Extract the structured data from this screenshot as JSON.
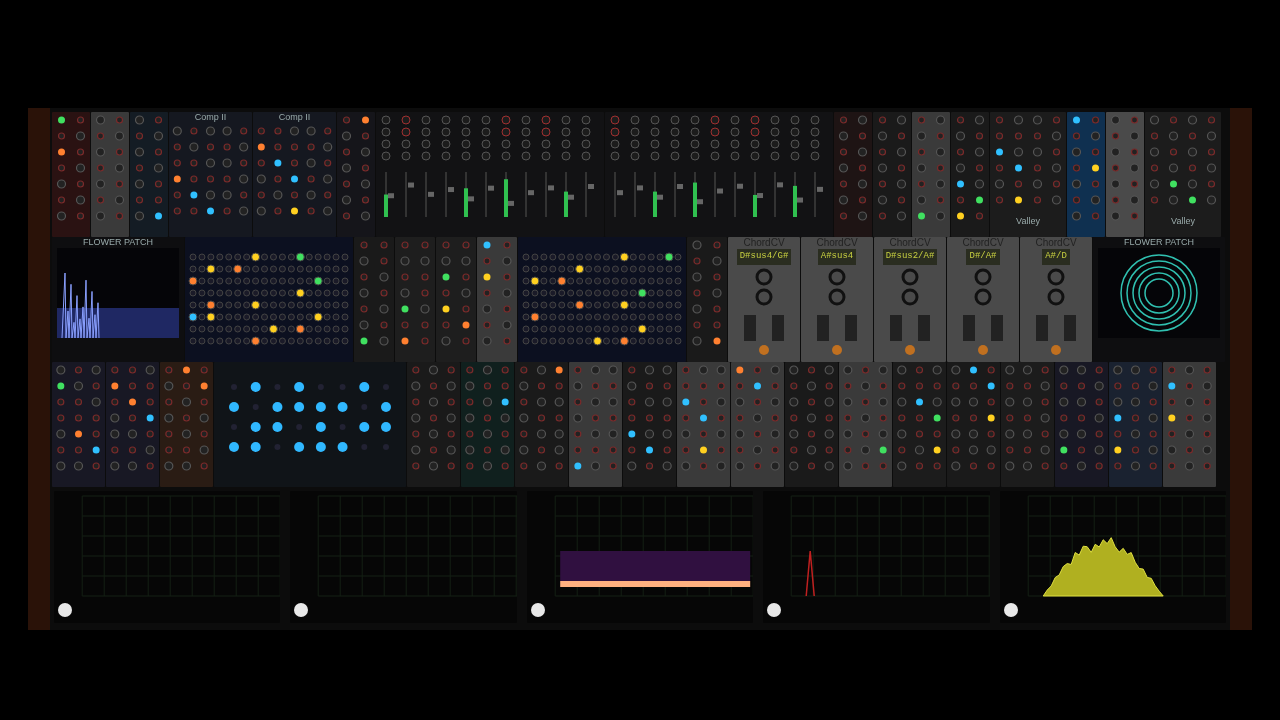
{
  "rack": {
    "rows": [
      {
        "modules": [
          {
            "kind": "panel",
            "color": "#2a1212"
          },
          {
            "kind": "panel",
            "color": "#3a3a3a"
          },
          {
            "kind": "panel",
            "color": "#141c24"
          },
          {
            "kind": "comp",
            "title": "Comp II"
          },
          {
            "kind": "comp",
            "title": "Comp II"
          },
          {
            "kind": "panel",
            "color": "#15151a"
          },
          {
            "kind": "mixer"
          },
          {
            "kind": "mixer"
          },
          {
            "kind": "panel",
            "color": "#1e1414"
          },
          {
            "kind": "panel",
            "color": "#1a1a1a"
          },
          {
            "kind": "panel",
            "color": "#3a3a3a"
          },
          {
            "kind": "panel",
            "color": "#1a1a1a"
          },
          {
            "kind": "valley",
            "title": "Valley",
            "color": "#1c1c1c"
          },
          {
            "kind": "panel",
            "color": "#0f3050"
          },
          {
            "kind": "panel",
            "color": "#4a4a4a"
          },
          {
            "kind": "valley",
            "title": "Valley",
            "color": "#1c1c1c"
          }
        ]
      },
      {
        "modules": [
          {
            "kind": "spectrum",
            "title": "FLOWER PATCH"
          },
          {
            "kind": "sequencer"
          },
          {
            "kind": "panel",
            "color": "#1a1a1a"
          },
          {
            "kind": "panel",
            "color": "#1e1e1e"
          },
          {
            "kind": "panel",
            "color": "#1e1e1e"
          },
          {
            "kind": "panel",
            "color": "#3a3a3a"
          },
          {
            "kind": "sequencer"
          },
          {
            "kind": "panel",
            "color": "#1a1a1a"
          },
          {
            "kind": "chordcv",
            "title": "ChordCV",
            "chord": "D#sus4/G#"
          },
          {
            "kind": "chordcv",
            "title": "ChordCV",
            "chord": "A#sus4"
          },
          {
            "kind": "chordcv",
            "title": "ChordCV",
            "chord": "D#sus2/A#"
          },
          {
            "kind": "chordcv",
            "title": "ChordCV",
            "chord": "D#/A#"
          },
          {
            "kind": "chordcv",
            "title": "ChordCV",
            "chord": "A#/D"
          },
          {
            "kind": "ring",
            "title": "FLOWER PATCH"
          }
        ]
      },
      {
        "modules": [
          {
            "kind": "panel",
            "color": "#181824"
          },
          {
            "kind": "panel",
            "color": "#181824"
          },
          {
            "kind": "panel",
            "color": "#2a1c14"
          },
          {
            "kind": "grid"
          },
          {
            "kind": "panel",
            "color": "#1a1a1a"
          },
          {
            "kind": "panel",
            "color": "#10201e"
          },
          {
            "kind": "panel",
            "color": "#1a1a1a"
          },
          {
            "kind": "panel",
            "color": "#3a3a3a"
          },
          {
            "kind": "panel",
            "color": "#1a1a1a"
          },
          {
            "kind": "panel",
            "color": "#3a3a3a"
          },
          {
            "kind": "panel",
            "color": "#3a3a3a"
          },
          {
            "kind": "panel",
            "color": "#1a1a1a"
          },
          {
            "kind": "panel",
            "color": "#3a3a3a"
          },
          {
            "kind": "panel",
            "color": "#1c1c1c"
          },
          {
            "kind": "panel",
            "color": "#1a1a1a"
          },
          {
            "kind": "panel",
            "color": "#1c1c1c"
          },
          {
            "kind": "panel",
            "color": "#181824"
          },
          {
            "kind": "panel",
            "color": "#1a2230"
          },
          {
            "kind": "panel",
            "color": "#3a3a3a"
          }
        ]
      },
      {
        "modules": [
          {
            "kind": "scope"
          },
          {
            "kind": "scope"
          },
          {
            "kind": "spectrogram"
          },
          {
            "kind": "peakscope"
          },
          {
            "kind": "analyzer"
          }
        ]
      }
    ]
  }
}
